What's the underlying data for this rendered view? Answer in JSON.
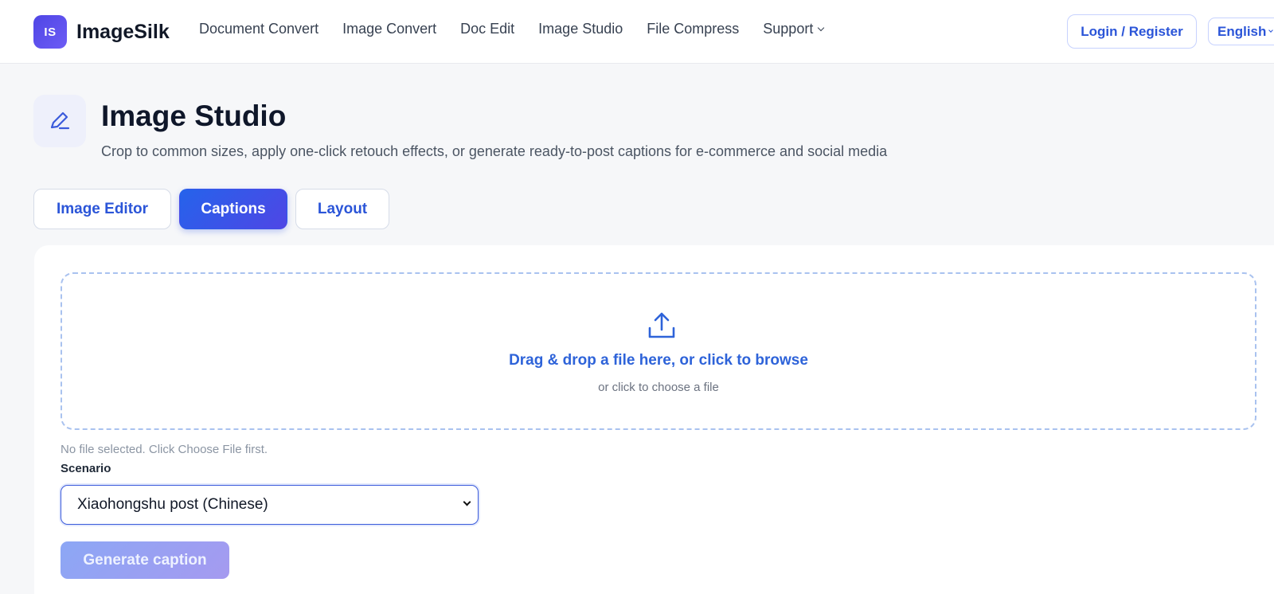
{
  "brand": {
    "logo_mark": "IS",
    "name": "ImageSilk",
    "accent": "#4f46e5"
  },
  "nav": {
    "items": [
      {
        "label": "Document Convert"
      },
      {
        "label": "Image Convert"
      },
      {
        "label": "Doc Edit"
      },
      {
        "label": "Image Studio"
      },
      {
        "label": "File Compress"
      },
      {
        "label": "Support",
        "has_dropdown": true
      }
    ],
    "login_label": "Login / Register",
    "language": "English"
  },
  "page": {
    "icon": "pen-edit-icon",
    "title": "Image Studio",
    "subtitle": "Crop to common sizes, apply one-click retouch effects, or generate ready-to-post captions for e-commerce and social media"
  },
  "tabs": [
    {
      "label": "Image Editor",
      "active": false
    },
    {
      "label": "Captions",
      "active": true
    },
    {
      "label": "Layout",
      "active": false
    }
  ],
  "upload": {
    "icon": "upload-icon",
    "primary_text": "Drag & drop a file here, or click to browse",
    "secondary_text": "or click to choose a file"
  },
  "form": {
    "status_text": "No file selected. Click Choose File first.",
    "scenario_label": "Scenario",
    "scenario_value": "Xiaohongshu post (Chinese)",
    "generate_label": "Generate caption"
  }
}
